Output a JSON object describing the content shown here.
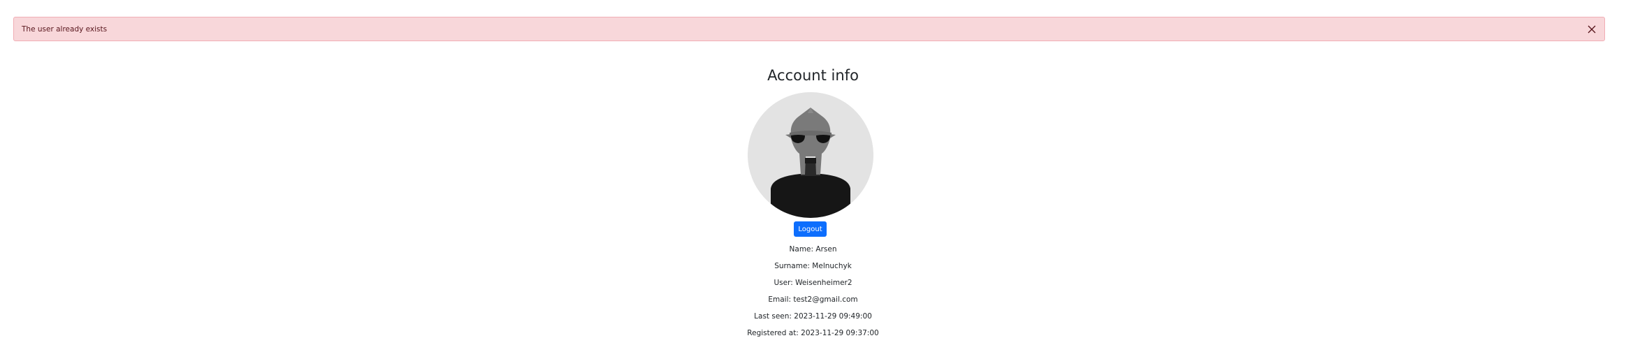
{
  "alert": {
    "message": "The user already exists",
    "close_icon": "close-icon"
  },
  "account": {
    "title": "Account info",
    "avatar_icon": "masked-villain-avatar",
    "logout_label": "Logout",
    "name": "Name: Arsen",
    "surname": "Surname: Melnuchyk",
    "user": "User: Weisenheimer2",
    "email": "Email: test2@gmail.com",
    "last_seen": "Last seen: 2023-11-29 09:49:00",
    "registered_at": "Registered at: 2023-11-29 09:37:00"
  },
  "colors": {
    "alert_bg": "#f8d7da",
    "alert_text": "#58151c",
    "button_bg": "#0d6efd",
    "avatar_bg": "#e3e3e3"
  }
}
